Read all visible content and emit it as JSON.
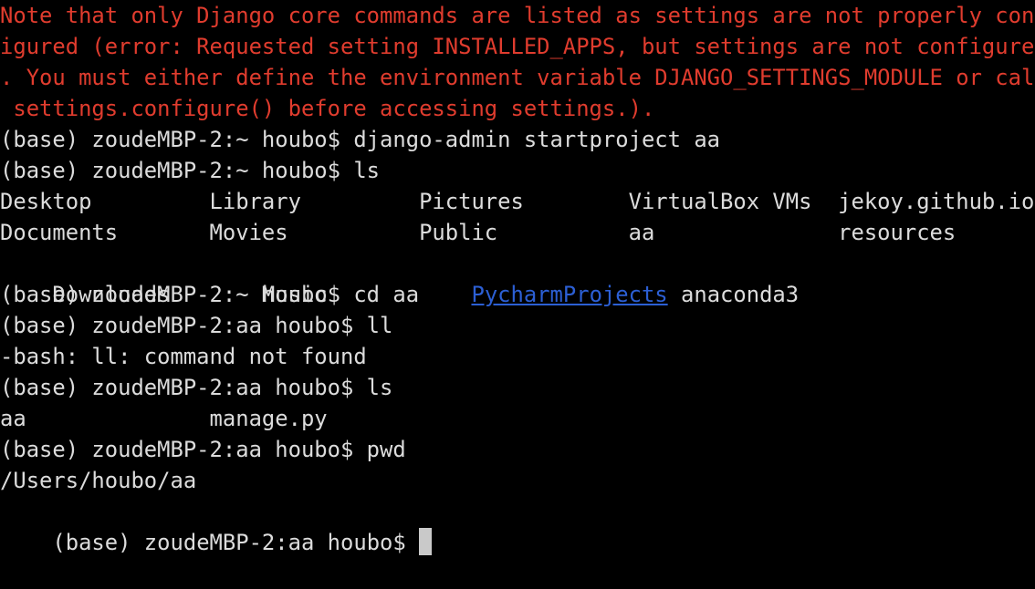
{
  "terminal": {
    "background_color": "#000000",
    "foreground_color": "#dcdcdc",
    "error_color": "#e03c2e",
    "link_color": "#2c5fd4",
    "cursor_color": "#c9c9c9",
    "cursor_glyph": " ",
    "columns": 79,
    "rows": 16,
    "lines": [
      {
        "id": "error-line-1",
        "style": "error",
        "text": "Note that only Django core commands are listed as settings are not properly conf"
      },
      {
        "id": "error-line-2",
        "style": "error",
        "text": "igured (error: Requested setting INSTALLED_APPS, but settings are not configured"
      },
      {
        "id": "error-line-3",
        "style": "error",
        "text": ". You must either define the environment variable DJANGO_SETTINGS_MODULE or call"
      },
      {
        "id": "error-line-4",
        "style": "error",
        "text": " settings.configure() before accessing settings.)."
      },
      {
        "id": "prompt-line-startproject",
        "style": "normal",
        "text": "(base) zoudeMBP-2:~ houbo$ django-admin startproject aa"
      },
      {
        "id": "prompt-line-ls-home",
        "style": "normal",
        "text": "(base) zoudeMBP-2:~ houbo$ ls"
      },
      {
        "id": "ls-home-row-1",
        "style": "normal",
        "text": "Desktop         Library         Pictures        VirtualBox VMs  jekoy.github.io"
      },
      {
        "id": "ls-home-row-2",
        "style": "normal",
        "text": "Documents       Movies          Public          aa              resources"
      },
      {
        "id": "ls-home-row-3",
        "style": "segments",
        "segments": [
          {
            "text": "Downloads       Music           ",
            "style": "normal"
          },
          {
            "text": "PycharmProjects",
            "style": "link"
          },
          {
            "text": " anaconda3",
            "style": "normal"
          }
        ],
        "text": "Downloads       Music           PycharmProjects anaconda3"
      },
      {
        "id": "prompt-line-cd-aa",
        "style": "normal",
        "text": "(base) zoudeMBP-2:~ houbo$ cd aa"
      },
      {
        "id": "prompt-line-ll",
        "style": "normal",
        "text": "(base) zoudeMBP-2:aa houbo$ ll"
      },
      {
        "id": "error-line-bash-ll",
        "style": "normal",
        "text": "-bash: ll: command not found"
      },
      {
        "id": "prompt-line-ls-aa",
        "style": "normal",
        "text": "(base) zoudeMBP-2:aa houbo$ ls"
      },
      {
        "id": "ls-aa-row-1",
        "style": "normal",
        "text": "aa              manage.py"
      },
      {
        "id": "prompt-line-pwd",
        "style": "normal",
        "text": "(base) zoudeMBP-2:aa houbo$ pwd"
      },
      {
        "id": "pwd-output",
        "style": "normal",
        "text": "/Users/houbo/aa"
      },
      {
        "id": "prompt-line-current",
        "style": "prompt-cursor",
        "text": "(base) zoudeMBP-2:aa houbo$ ",
        "has_cursor": true
      }
    ]
  }
}
